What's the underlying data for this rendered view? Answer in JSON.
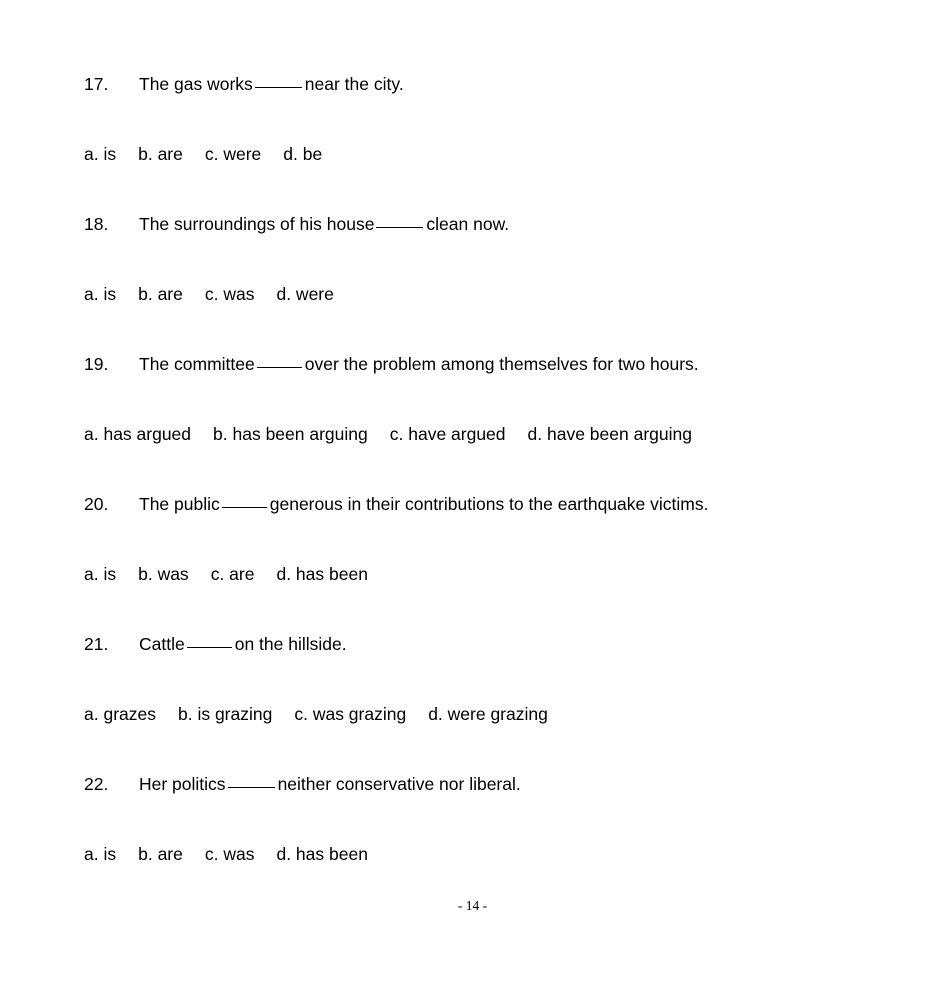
{
  "document": {
    "page_label": "- 14 -",
    "questions": [
      {
        "number": "17.",
        "text_before": "The gas works",
        "blank": "_____",
        "text_after": "near the city.",
        "options": [
          "a. is",
          "b. are",
          "c. were",
          "d. be"
        ]
      },
      {
        "number": "18.",
        "text_before": "The surroundings of his house",
        "blank": "_____",
        "text_after": "clean now.",
        "options": [
          "a. is",
          "b. are",
          "c. was",
          "d. were"
        ]
      },
      {
        "number": "19.",
        "text_before": "The committee",
        "blank": "____",
        "text_after": "over the problem among themselves for two hours.",
        "options": [
          "a. has argued",
          "b. has been arguing",
          "c. have argued",
          "d. have been arguing"
        ]
      },
      {
        "number": "20.",
        "text_before": "The public",
        "blank": "____",
        "text_after": "generous in their contributions to the earthquake victims.",
        "options": [
          "a. is",
          "b. was",
          "c. are",
          "d. has been"
        ]
      },
      {
        "number": "21.",
        "text_before": "Cattle",
        "blank": "____",
        "text_after": "on the hillside.",
        "options": [
          "a. grazes",
          "b. is grazing",
          "c. was grazing",
          "d. were grazing"
        ]
      },
      {
        "number": "22.",
        "text_before": "Her politics",
        "blank": "_____",
        "text_after": "neither conservative nor liberal.",
        "options": [
          "a. is",
          "b. are",
          "c. was",
          "d. has been"
        ]
      }
    ]
  }
}
